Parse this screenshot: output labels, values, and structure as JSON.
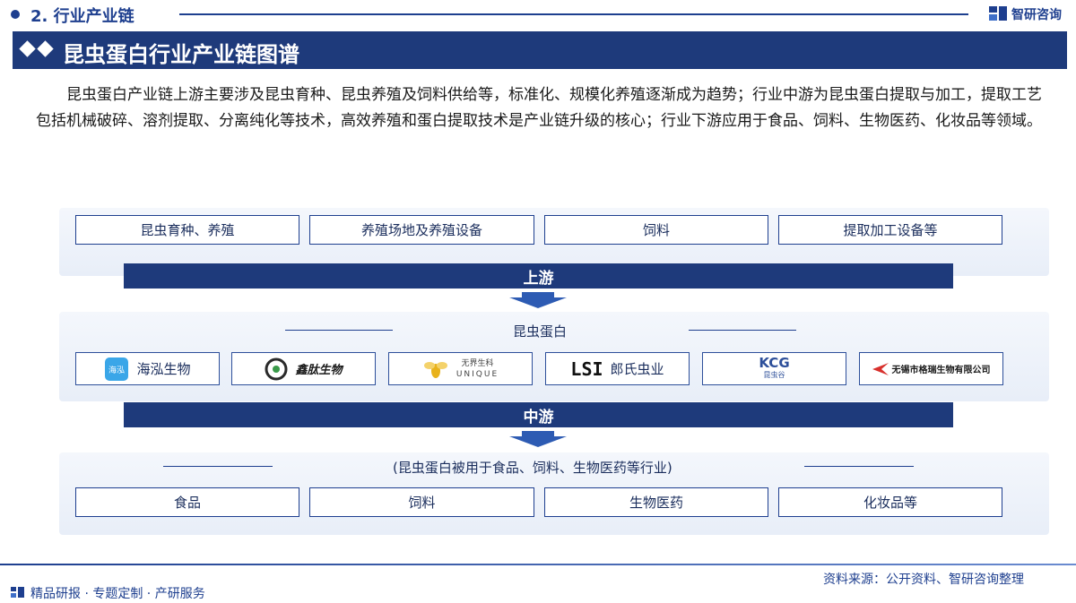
{
  "header": {
    "section": "2. 行业产业链",
    "brand": "智研咨询",
    "title": "昆虫蛋白行业产业链图谱"
  },
  "intro": "昆虫蛋白产业链上游主要涉及昆虫育种、昆虫养殖及饲料供给等，标准化、规模化养殖逐渐成为趋势；行业中游为昆虫蛋白提取与加工，提取工艺包括机械破碎、溶剂提取、分离纯化等技术，高效养殖和蛋白提取技术是产业链升级的核心；行业下游应用于食品、饲料、生物医药、化妆品等领域。",
  "upstream": {
    "label": "上游",
    "items": [
      "昆虫育种、养殖",
      "养殖场地及养殖设备",
      "饲料",
      "提取加工设备等"
    ]
  },
  "midstream": {
    "label": "中游",
    "caption": "昆虫蛋白",
    "companies": [
      {
        "name": "海泓生物",
        "logo": "haihong-logo",
        "logo_text": "海泓"
      },
      {
        "name": "鑫肽生物",
        "logo": "xintai-logo",
        "logo_text": ""
      },
      {
        "name": "",
        "logo": "unique-logo",
        "logo_text": "无界生科",
        "logo_text2": "UNIQUE"
      },
      {
        "name": "郎氏虫业",
        "logo": "lsi-logo",
        "logo_text": "LSI"
      },
      {
        "name": "",
        "logo": "kcg-logo",
        "logo_text": "KCG",
        "logo_text2": "昆虫谷"
      },
      {
        "name": "无锡市格瑞生物有限公司",
        "logo": "gerui-logo",
        "logo_text": ""
      }
    ]
  },
  "downstream": {
    "caption": "(昆虫蛋白被用于食品、饲料、生物医药等行业)",
    "items": [
      "食品",
      "饲料",
      "生物医药",
      "化妆品等"
    ]
  },
  "footer": {
    "left": "精品研报 · 专题定制 · 产研服务",
    "source": "资料来源：公开资料、智研咨询整理"
  },
  "colors": {
    "primary": "#1e3a7b",
    "accent": "#1e3f8f"
  }
}
